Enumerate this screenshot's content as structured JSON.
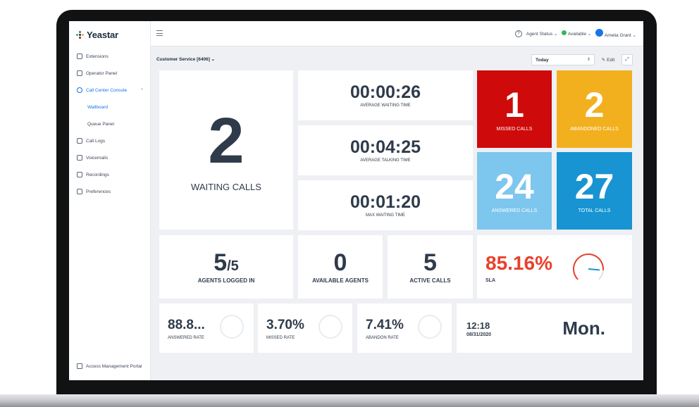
{
  "brand": {
    "name": "Yeastar"
  },
  "sidebar": {
    "items": [
      {
        "label": "Extensions",
        "icon": "extensions-icon"
      },
      {
        "label": "Operator Panel",
        "icon": "operator-panel-icon"
      },
      {
        "label": "Call Center Console",
        "icon": "headset-icon"
      },
      {
        "label": "Call Logs",
        "icon": "call-logs-icon"
      },
      {
        "label": "Voicemails",
        "icon": "voicemail-icon"
      },
      {
        "label": "Recordings",
        "icon": "microphone-icon"
      },
      {
        "label": "Preferences",
        "icon": "preferences-icon"
      }
    ],
    "subitems": [
      {
        "label": "Wallboard"
      },
      {
        "label": "Queue Panel"
      }
    ],
    "footer": {
      "label": "Access Management Portal"
    }
  },
  "topbar": {
    "agent_status": "Agent Status",
    "availability": "Available",
    "user": "Amelia Grant"
  },
  "header": {
    "queue": "Customer Service [6406]",
    "date_range": "Today",
    "edit_label": "Edit"
  },
  "waiting": {
    "value": "2",
    "label": "WAITING CALLS"
  },
  "times": [
    {
      "value": "00:00:26",
      "label": "AVERAGE WAITING TIME"
    },
    {
      "value": "00:04:25",
      "label": "AVERAGE TALKING TIME"
    },
    {
      "value": "00:01:20",
      "label": "MAX WAITING TIME"
    }
  ],
  "stats": [
    {
      "value": "1",
      "label": "MISSED CALLS",
      "color": "#cf0a0a"
    },
    {
      "value": "2",
      "label": "ABANDONED CALLS",
      "color": "#f2b01e"
    },
    {
      "value": "24",
      "label": "ANSWERED CALLS",
      "color": "#7dc6ee"
    },
    {
      "value": "27",
      "label": "TOTAL CALLS",
      "color": "#1794d1"
    }
  ],
  "agents": {
    "logged_in": {
      "value": "5",
      "total": "/5",
      "label": "AGENTS LOGGED IN"
    },
    "available": {
      "value": "0",
      "label": "AVAILABLE AGENTS"
    },
    "active_calls": {
      "value": "5",
      "label": "ACTIVE CALLS"
    }
  },
  "sla": {
    "value": "85.16%",
    "label": "SLA",
    "color": "#e8412c",
    "gauge_fraction": 0.8516
  },
  "rates": [
    {
      "value": "88.8...",
      "label": "ANSWERED RATE"
    },
    {
      "value": "3.70%",
      "label": "MISSED RATE"
    },
    {
      "value": "7.41%",
      "label": "ABANDON RATE"
    }
  ],
  "clock": {
    "time": "12:18",
    "date": "08/31/2020",
    "day": "Mon."
  },
  "colors": {
    "accent": "#1a73e8",
    "text": "#2f3b4b",
    "background": "#eef0f4"
  }
}
